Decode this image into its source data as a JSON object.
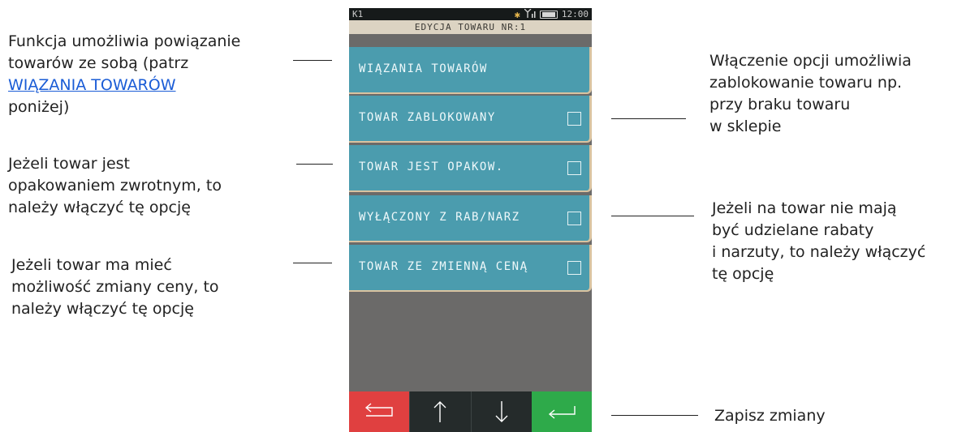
{
  "device": {
    "status_left": "K1",
    "clock": "12:00",
    "title": "EDYCJA TOWARU NR:1",
    "menu_items": [
      {
        "label": "WIĄZANIA TOWARÓW",
        "has_checkbox": false,
        "checked": false
      },
      {
        "label": "TOWAR ZABLOKOWANY",
        "has_checkbox": true,
        "checked": false
      },
      {
        "label": "TOWAR JEST OPAKOW.",
        "has_checkbox": true,
        "checked": false
      },
      {
        "label": "WYŁĄCZONY Z RAB/NARZ",
        "has_checkbox": true,
        "checked": false
      },
      {
        "label": "TOWAR ZE ZMIENNĄ CENĄ",
        "has_checkbox": true,
        "checked": false
      }
    ],
    "nav_buttons": [
      "back-arrow-icon",
      "up-arrow-icon",
      "down-arrow-icon",
      "enter-arrow-icon"
    ],
    "colors": {
      "item_bg": "#4b9cae",
      "back": "#e04040",
      "ok": "#2eaa4a",
      "nav_dark": "#252b2b",
      "body": "#6b6a69"
    }
  },
  "annotations": {
    "linking": {
      "line1": "Funkcja umożliwia powiązanie",
      "line2": "towarów ze sobą (patrz",
      "link": "WIĄZANIA TOWARÓW",
      "line4": "poniżej)"
    },
    "packaging": {
      "line1": "Jeżeli towar jest",
      "line2": "opakowaniem zwrotnym, to",
      "line3": "należy włączyć tę opcję"
    },
    "variable_price": {
      "line1": "Jeżeli towar ma mieć",
      "line2": "możliwość zmiany ceny, to",
      "line3": "należy włączyć tę opcję"
    },
    "blocked": {
      "line1": "Włączenie opcji umożliwia",
      "line2": "zablokowanie towaru np.",
      "line3": "przy braku towaru",
      "line4": "w sklepie"
    },
    "discounts": {
      "line1": "Jeżeli na towar nie mają",
      "line2": "być udzielane rabaty",
      "line3": "i narzuty, to należy włączyć",
      "line4": "tę opcję"
    },
    "save": {
      "text": "Zapisz zmiany"
    }
  }
}
